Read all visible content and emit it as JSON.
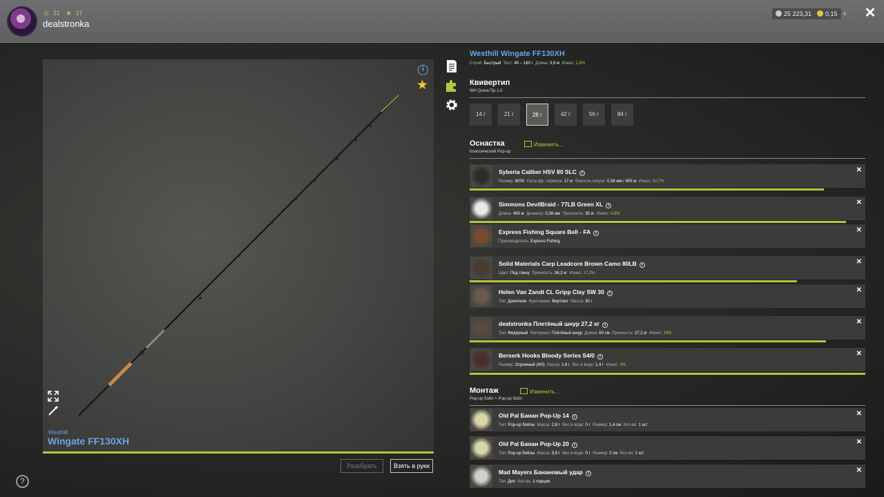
{
  "header": {
    "level": "31",
    "stars": "17",
    "username": "dealstronka",
    "silver": "25 223,31",
    "gold": "0,15",
    "plus": "+",
    "close": "✕"
  },
  "viewer": {
    "brand": "Westhill",
    "name": "Wingate FF130XH",
    "btn_disassemble": "Разобрать",
    "btn_take": "Взять в руки"
  },
  "rod": {
    "title": "Westhill Wingate FF130XH",
    "meta": {
      "build_label": "Строй:",
      "build": "Быстрый",
      "test_label": "Тест:",
      "test": "40 – 160 г",
      "length_label": "Длина:",
      "length": "3,9 м",
      "wear_label": "Износ:",
      "wear": "1,6%"
    }
  },
  "quivertip": {
    "title": "Квивертип",
    "sub": "WH QuiverTip 1.0",
    "options": [
      "14 г",
      "21 г",
      "28 г",
      "42 г",
      "56 г",
      "84 г"
    ],
    "selected": "28 г"
  },
  "tackle": {
    "title": "Оснастка",
    "edit": "Изменить...",
    "sub": "Классический Pop-up",
    "items": [
      {
        "name": "Syberia Caliber HSV 80 SLC",
        "meta": [
          [
            "Размер:",
            "8000"
          ],
          [
            "Сила фр. тормоза:",
            "17 кг"
          ],
          [
            "Ёмкость шпули:",
            "0,38 мм / 455 м"
          ]
        ],
        "wear_label": "Износ:",
        "wear": "10,7%",
        "wear_pct": 89.5
      },
      {
        "name": "Simmons DevilBraid - 77LB Green XL",
        "meta": [
          [
            "Длина:",
            "450 м"
          ],
          [
            "Диаметр:",
            "0,38 мм"
          ],
          [
            "Прочность:",
            "35 кг"
          ]
        ],
        "wear_label": "Износ:",
        "wear": "4,9%",
        "wear_pct": 95.1
      },
      {
        "name": "Express Fishing Square Bell - FA",
        "meta": [
          [
            "Производитель:",
            "Express Fishing"
          ]
        ]
      },
      {
        "name": "Solid Materials Carp Leadcore Brown Camo 80LB",
        "meta": [
          [
            "Цвет:",
            "Под глину"
          ],
          [
            "Прочность:",
            "36,2 кг"
          ]
        ],
        "wear_label": "Износ:",
        "wear": "17,2%",
        "wear_pct": 82.8
      },
      {
        "name": "Helen Van Zandt CL Gripp Clay SW 30",
        "meta": [
          [
            "Тип:",
            "Доночное"
          ],
          [
            "Крепление:",
            "Вертлюг"
          ],
          [
            "Масса:",
            "30 г"
          ]
        ]
      },
      {
        "name": "dealstronka Плетёный шнур 27,2 кг",
        "meta": [
          [
            "Тип:",
            "Фидерный"
          ],
          [
            "Материал:",
            "Плетёный шнур"
          ],
          [
            "Длина:",
            "60 см"
          ],
          [
            "Прочность:",
            "27,2 кг"
          ]
        ],
        "wear_label": "Износ:",
        "wear": "10%",
        "wear_pct": 90
      },
      {
        "name": "Berserk Hooks Bloody Series S4/0",
        "meta": [
          [
            "Размер:",
            "Огромный (4/0)"
          ],
          [
            "Масса:",
            "1,6 г"
          ],
          [
            "Вес в воде:",
            "1,4 г"
          ]
        ],
        "wear_label": "Износ:",
        "wear": "0%",
        "wear_pct": 100
      }
    ]
  },
  "rig": {
    "title": "Монтаж",
    "edit": "Изменить...",
    "sub": "Pop-up бойл + Pop-up бойл",
    "items": [
      {
        "name": "Old Pal Банан Pop-Up 14",
        "meta": [
          [
            "Тип:",
            "Pop-up бойлы"
          ],
          [
            "Масса:",
            "2,6 г"
          ],
          [
            "Вес в воде:",
            "0 г"
          ],
          [
            "Размер:",
            "1,4 см"
          ],
          [
            "Кол-во:",
            "1 шт"
          ]
        ]
      },
      {
        "name": "Old Pal Банан Pop-Up 20",
        "meta": [
          [
            "Тип:",
            "Pop-up бойлы"
          ],
          [
            "Масса:",
            "3,8 г"
          ],
          [
            "Вес в воде:",
            "0 г"
          ],
          [
            "Размер:",
            "2 см"
          ],
          [
            "Кол-во:",
            "1 шт"
          ]
        ]
      },
      {
        "name": "Mad Mayers Банановый удар",
        "meta": [
          [
            "Тип:",
            "Дип"
          ],
          [
            "Кол-во:",
            "1 порция"
          ]
        ]
      }
    ]
  },
  "colors": {
    "accent": "#b6c53f",
    "link": "#6aa6e6",
    "panel": "#3b3b39"
  }
}
